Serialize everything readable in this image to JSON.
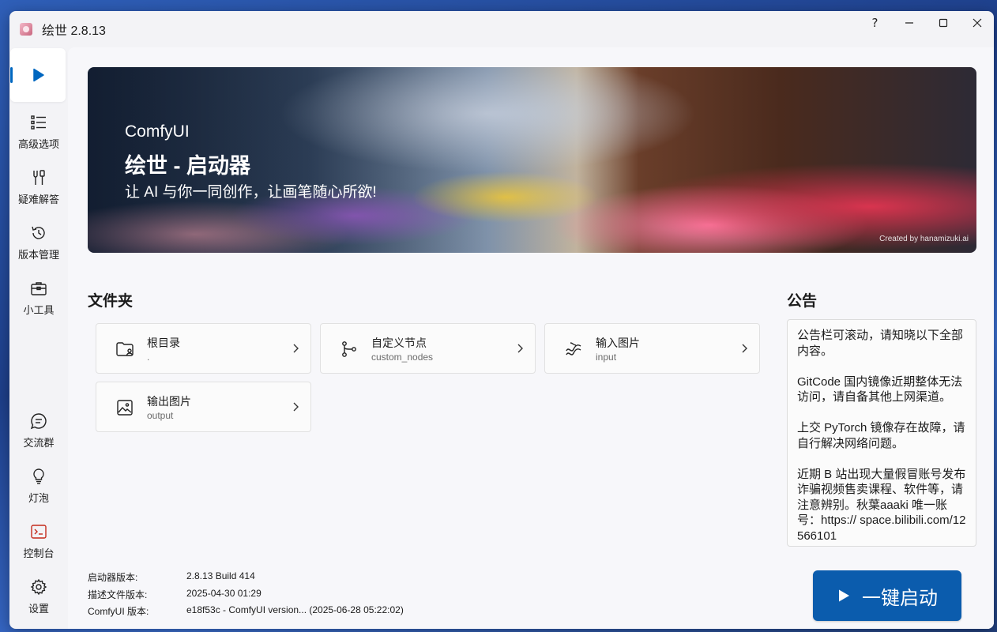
{
  "window": {
    "title": "绘世 2.8.13",
    "controls": {
      "help": "?",
      "minimize": "—",
      "maximize": "☐",
      "close": "✕"
    }
  },
  "sidebar": {
    "top_items": [
      {
        "id": "launch",
        "icon": "play-icon",
        "label": ""
      },
      {
        "id": "advanced",
        "icon": "list-icon",
        "label": "高级选项"
      },
      {
        "id": "troubleshoot",
        "icon": "tools-icon",
        "label": "疑难解答"
      },
      {
        "id": "versions",
        "icon": "history-icon",
        "label": "版本管理"
      },
      {
        "id": "tools",
        "icon": "toolbox-icon",
        "label": "小工具"
      }
    ],
    "bottom_items": [
      {
        "id": "community",
        "icon": "chat-icon",
        "label": "交流群"
      },
      {
        "id": "bulb",
        "icon": "lightbulb-icon",
        "label": "灯泡"
      },
      {
        "id": "console",
        "icon": "terminal-icon",
        "label": "控制台"
      },
      {
        "id": "settings",
        "icon": "gear-icon",
        "label": "设置"
      }
    ],
    "accent": "#0067c0"
  },
  "banner": {
    "subtitle": "ComfyUI",
    "title": "绘世 - 启动器",
    "slogan": "让 AI 与你一同创作，让画笔随心所欲!",
    "credit": "Created by hanamizuki.ai"
  },
  "folders": {
    "heading": "文件夹",
    "items": [
      {
        "name": "根目录",
        "path": ".",
        "icon": "folder-user-icon"
      },
      {
        "name": "自定义节点",
        "path": "custom_nodes",
        "icon": "branch-icon"
      },
      {
        "name": "输入图片",
        "path": "input",
        "icon": "image-input-icon"
      },
      {
        "name": "输出图片",
        "path": "output",
        "icon": "image-icon"
      }
    ]
  },
  "notice": {
    "heading": "公告",
    "paragraphs": [
      "公告栏可滚动，请知晓以下全部内容。",
      "GitCode 国内镜像近期整体无法访问，请自备其他上网渠道。",
      "上交 PyTorch 镜像存在故障，请自行解决网络问题。",
      "近期 B 站出现大量假冒账号发布诈骗视频售卖课程、软件等，请注意辨别。秋葉aaaki 唯一账号：https:// space.bilibili.com/12566101"
    ]
  },
  "info": {
    "launcher_version_label": "启动器版本:",
    "launcher_version": "2.8.13 Build 414",
    "desc_version_label": "描述文件版本:",
    "desc_version": "2025-04-30 01:29",
    "comfy_version_label": "ComfyUI 版本:",
    "comfy_version": "e18f53c - ComfyUI version... (2025-06-28 05:22:02)"
  },
  "launch_button": {
    "label": "一键启动",
    "icon": "play-icon",
    "color": "#0b5cad"
  }
}
